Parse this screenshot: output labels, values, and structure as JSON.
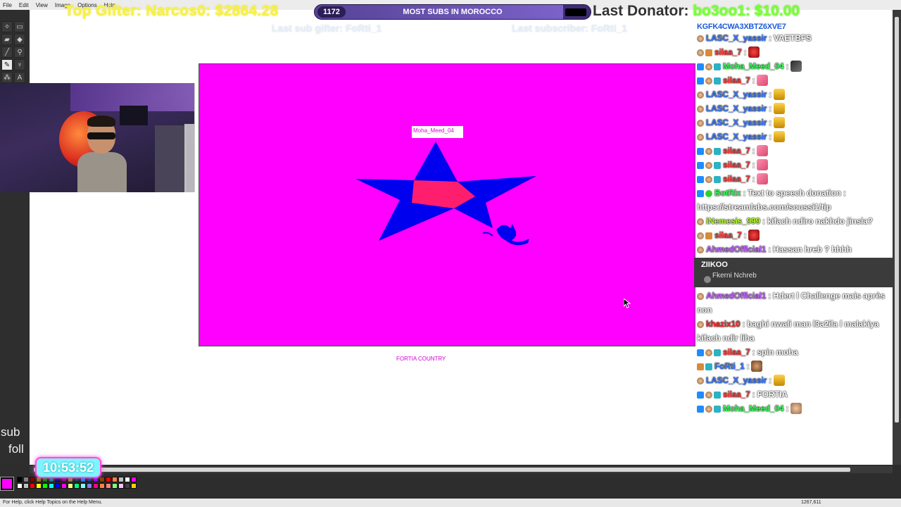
{
  "menu": [
    "File",
    "Edit",
    "View",
    "Image",
    "Options",
    "Help"
  ],
  "overlay": {
    "top_gifter": "Top Gifter: Narcos0: $2864.28",
    "last_donator_label": "Last Donator:",
    "last_donator_value": "bo3oo1: $10.00",
    "sub_count": "1172",
    "sub_goal_label": "MOST SUBS IN MOROCCO",
    "sub_goal_progress": 0.9,
    "last_sub_gifter": "Last sub gifter: FoRti_1",
    "last_subscriber": "Last subscriber: FoRti_1"
  },
  "canvas": {
    "nametag": "Moha_Meed_04",
    "caption": "FORTIA COUNTRY",
    "background": "#ff00ff",
    "star_outer": "#0000ee",
    "star_inner": "#ff1e6e"
  },
  "left": {
    "sub_text": "sub",
    "foll_text": "foll",
    "timer": "10:53:52"
  },
  "status": {
    "help": "For Help, click Help Topics on the Help Menu.",
    "coords": "1267,611"
  },
  "chat": {
    "topline": "KGFK4CWA3XBTZ6XVE7",
    "messages": [
      {
        "badges": [
          "round"
        ],
        "user": "LASC_X_yassir",
        "color": "#3a7bff",
        "text": "VAETBFS",
        "emote": ""
      },
      {
        "badges": [
          "round",
          "gift"
        ],
        "user": "silaa_7",
        "color": "#ff3c3c",
        "text": "",
        "emote": "red"
      },
      {
        "badges": [
          "prime",
          "round",
          "sub"
        ],
        "user": "Moha_Meed_04",
        "color": "#39ff5a",
        "text": "",
        "emote": "dark"
      },
      {
        "badges": [
          "prime",
          "round",
          "sub"
        ],
        "user": "silaa_7",
        "color": "#ff3c3c",
        "text": "",
        "emote": "pink"
      },
      {
        "badges": [
          "round"
        ],
        "user": "LASC_X_yassir",
        "color": "#3a7bff",
        "text": "",
        "emote": "yellow"
      },
      {
        "badges": [
          "round"
        ],
        "user": "LASC_X_yassir",
        "color": "#3a7bff",
        "text": "",
        "emote": "yellow"
      },
      {
        "badges": [
          "round"
        ],
        "user": "LASC_X_yassir",
        "color": "#3a7bff",
        "text": "",
        "emote": "yellow"
      },
      {
        "badges": [
          "round"
        ],
        "user": "LASC_X_yassir",
        "color": "#3a7bff",
        "text": "",
        "emote": "yellow"
      },
      {
        "badges": [
          "prime",
          "round",
          "sub"
        ],
        "user": "silaa_7",
        "color": "#ff3c3c",
        "text": "",
        "emote": "pink"
      },
      {
        "badges": [
          "prime",
          "round",
          "sub"
        ],
        "user": "silaa_7",
        "color": "#ff3c3c",
        "text": "",
        "emote": "pink"
      },
      {
        "badges": [
          "prime",
          "round",
          "sub"
        ],
        "user": "silaa_7",
        "color": "#ff3c3c",
        "text": "",
        "emote": "pink"
      },
      {
        "badges": [
          "prime",
          "verified"
        ],
        "user": "BotRix",
        "color": "#39ff5a",
        "text": "Text to speech donation : https://streamlabs.com/soussi1/tip",
        "emote": ""
      },
      {
        "badges": [
          "round"
        ],
        "user": "iNemesis_999",
        "color": "#b6ff2a",
        "text": "kifach ndiro nakhdo jinsia?",
        "emote": ""
      },
      {
        "badges": [
          "round",
          "gift"
        ],
        "user": "silaa_7",
        "color": "#ff3c3c",
        "text": "",
        "emote": "red"
      },
      {
        "badges": [
          "round"
        ],
        "user": "AhmedOfficial1",
        "color": "#c060ff",
        "text": "Hassan hreb ? hhhh",
        "emote": ""
      }
    ],
    "alert": {
      "title": "ZIIKOO",
      "sub": "Fkerni Nchreb"
    },
    "messages2": [
      {
        "badges": [
          "round"
        ],
        "user": "AhmedOfficial1",
        "color": "#c060ff",
        "text": "Hdert l Challenge mais après non",
        "emote": ""
      },
      {
        "badges": [
          "round"
        ],
        "user": "khazix10",
        "color": "#ff2a2a",
        "text": "baghi nwali man l3a2ila l malakiya kifach ndir liha",
        "emote": ""
      },
      {
        "badges": [
          "prime",
          "round",
          "sub"
        ],
        "user": "silaa_7",
        "color": "#ff3c3c",
        "text": "spin moha",
        "emote": ""
      },
      {
        "badges": [
          "gift",
          "sub"
        ],
        "user": "FoRti_1",
        "color": "#3a7bff",
        "text": "",
        "emote": "face"
      },
      {
        "badges": [
          "round"
        ],
        "user": "LASC_X_yassir",
        "color": "#3a7bff",
        "text": "",
        "emote": "yellow"
      },
      {
        "badges": [
          "prime",
          "round",
          "sub"
        ],
        "user": "silaa_7",
        "color": "#ff3c3c",
        "text": "FORTIA",
        "emote": ""
      },
      {
        "badges": [
          "prime",
          "round",
          "sub"
        ],
        "user": "Moha_Meed_04",
        "color": "#39ff5a",
        "text": "",
        "emote": "hand"
      }
    ]
  },
  "palette": [
    "#000000",
    "#808080",
    "#800000",
    "#808000",
    "#008000",
    "#008080",
    "#000080",
    "#800080",
    "#808040",
    "#004040",
    "#0080ff",
    "#004080",
    "#8000ff",
    "#804000",
    "#ff0000",
    "#ff8040",
    "#c0c0c0",
    "#ffffff",
    "#ff00ff",
    "#ffffff",
    "#c0c0c0",
    "#ff0000",
    "#ffff00",
    "#00ff00",
    "#00ffff",
    "#0000ff",
    "#ff00ff",
    "#ffff80",
    "#00ff80",
    "#80ffff",
    "#8080ff",
    "#ff0080",
    "#ff8040",
    "#ff8080",
    "#80ff80",
    "#ffc0ff",
    "#404040",
    "#ffcc00"
  ]
}
